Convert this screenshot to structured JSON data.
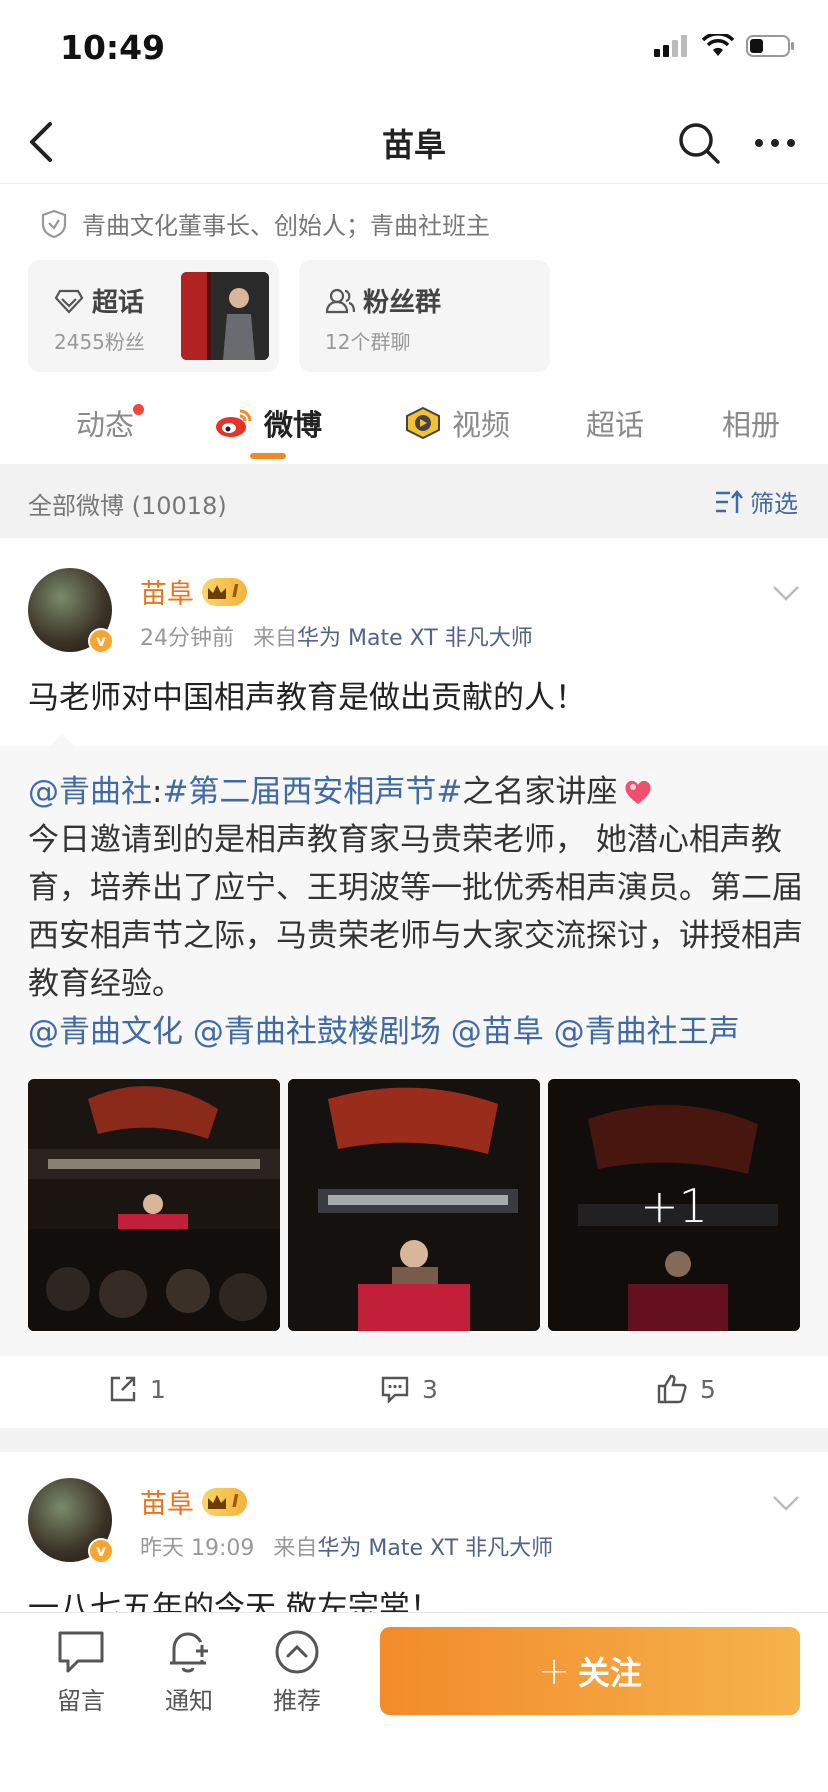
{
  "status_bar": {
    "time": "10:49"
  },
  "nav": {
    "title": "苗阜"
  },
  "profile": {
    "bio": "青曲文化董事长、创始人；青曲社班主"
  },
  "cards": [
    {
      "title": "超话",
      "subtitle": "2455粉丝"
    },
    {
      "title": "粉丝群",
      "subtitle": "12个群聊"
    }
  ],
  "tabs": [
    {
      "label": "动态"
    },
    {
      "label": "微博"
    },
    {
      "label": "视频"
    },
    {
      "label": "超话"
    },
    {
      "label": "相册"
    }
  ],
  "filter": {
    "count_label": "全部微博 (10018)",
    "filter_label": "筛选"
  },
  "posts": [
    {
      "author": "苗阜",
      "vip_level": "I",
      "time": "24分钟前",
      "source_prefix": "来自",
      "source": "华为 Mate XT 非凡大师",
      "text": "马老师对中国相声教育是做出贡献的人！",
      "repost": {
        "mention": "@青曲社",
        "colon": ":",
        "hashtag": "#第二届西安相声节#",
        "intro": "之名家讲座",
        "body": "今日邀请到的是相声教育家马贵荣老师， 她潜心相声教育，培养出了应宁、王玥波等一批优秀相声演员。第二届西安相声节之际，马贵荣老师与大家交流探讨，讲授相声教育经验。",
        "tags": [
          "@青曲文化",
          "@青曲社鼓楼剧场",
          "@苗阜",
          "@青曲社王声"
        ],
        "more_photos": "+1"
      },
      "reposts": "1",
      "comments": "3",
      "likes": "5"
    },
    {
      "author": "苗阜",
      "vip_level": "I",
      "time": "昨天 19:09",
      "source_prefix": "来自",
      "source": "华为 Mate XT 非凡大师",
      "text": "一八七五年的今天 敬左宗棠！"
    }
  ],
  "bottom_bar": {
    "comment_label": "留言",
    "notify_label": "通知",
    "recommend_label": "推荐",
    "follow_label": "关注",
    "follow_plus": "+"
  }
}
